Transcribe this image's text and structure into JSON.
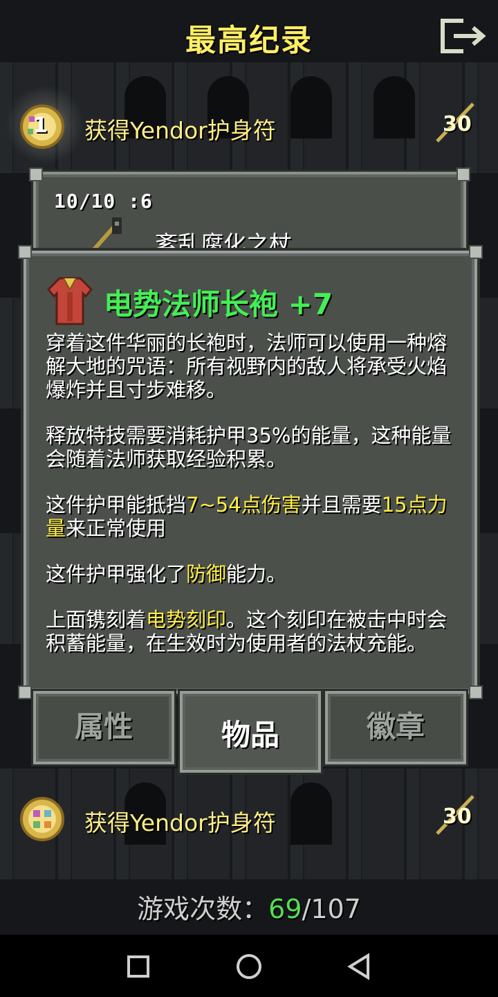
{
  "header": {
    "title": "最高纪录",
    "exit_icon": "exit-icon"
  },
  "records": [
    {
      "rank": "1",
      "text": "获得Yendor护身符",
      "score": "30"
    },
    {
      "rank": "",
      "text": "获得Yendor护身符",
      "score": "30"
    }
  ],
  "back_window": {
    "stats": "10/10 :6",
    "item_name": "紊乱腐化之杖"
  },
  "item_window": {
    "title": "电势法师长袍 +7",
    "p1": "穿着这件华丽的长袍时，法师可以使用一种熔解大地的咒语：所有视野内的敌人将承受火焰爆炸并且寸步难移。",
    "p2": "释放特技需要消耗护甲35%的能量，这种能量会随着法师获取经验积累。",
    "p3_a": "这件护甲能抵挡",
    "p3_b": "7~54点伤害",
    "p3_c": "并且需要",
    "p3_d": "15点力量",
    "p3_e": "来正常使用",
    "p4_a": "这件护甲强化了",
    "p4_b": "防御",
    "p4_c": "能力。",
    "p5_a": "上面镌刻着",
    "p5_b": "电势刻印",
    "p5_c": "。这个刻印在被击中时会积蓄能量，在生效时为使用者的法杖充能。"
  },
  "tabs": {
    "attributes": "属性",
    "items": "物品",
    "badges": "徽章"
  },
  "games": {
    "label": "游戏次数：",
    "won": "69",
    "total": "/107"
  },
  "colors": {
    "title": "#ffee66",
    "item_title": "#44ee55",
    "highlight": "#ffee44",
    "won": "#55dd55"
  }
}
